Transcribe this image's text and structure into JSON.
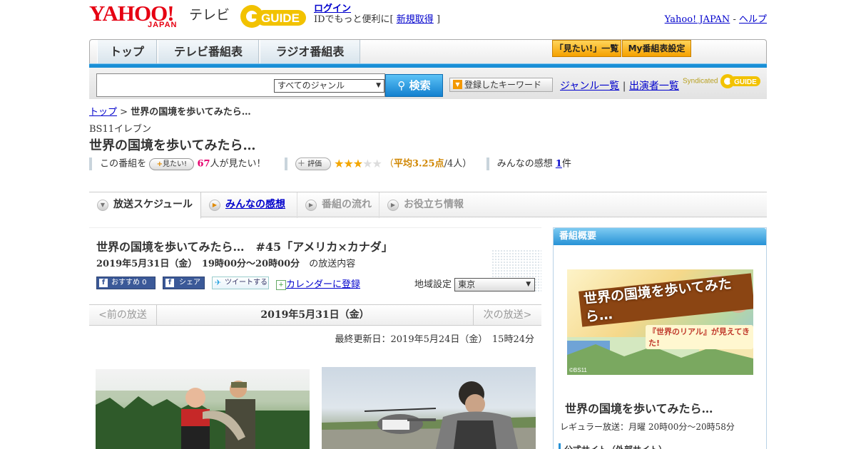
{
  "header": {
    "yahoo_word": "YAHOO!",
    "yahoo_japan": "JAPAN",
    "tv": "テレビ",
    "gguide": "GUIDE",
    "login": "ログイン",
    "id_text": "IDでもっと便利に[",
    "signup": "新規取得",
    "id_close": "]",
    "yahoo_japan_link": "Yahoo! JAPAN",
    "dash": "-",
    "help": "ヘルプ"
  },
  "nav": {
    "tabs": [
      "トップ",
      "テレビ番組表",
      "ラジオ番組表"
    ],
    "mitai_list": "「見たい!」一覧",
    "my_program": "My番組表設定"
  },
  "search": {
    "genre_selected": "すべてのジャンル",
    "search_button": "検索",
    "keyword_button": "登録したキーワード",
    "genre_list": "ジャンル一覧",
    "pipe": "|",
    "cast_list": "出演者一覧",
    "syndicated": "Syndicated",
    "gguide": "GUIDE"
  },
  "breadcrumb": {
    "top": "トップ",
    "sep": " > ",
    "current": "世界の国境を歩いてみたら…"
  },
  "program": {
    "station": "BS11イレブン",
    "title": "世界の国境を歩いてみたら…",
    "kono_bangumi": "この番組を",
    "mitai_btn": "見たい!",
    "mitai_count": "67",
    "mitai_suffix": "人が見たい！",
    "hyouka_btn": "評価",
    "rating": 3.25,
    "avg_prefix": "（",
    "avg_label": "平均3.25点",
    "avg_suffix": "/4人）",
    "kansou_label": "みんなの感想",
    "kansou_count": "1",
    "kansou_unit": "件"
  },
  "subtabs": [
    "放送スケジュール",
    "みんなの感想",
    "番組の流れ",
    "お役立ち情報"
  ],
  "episode": {
    "title": "世界の国境を歩いてみたら…　#45「アメリカ×カナダ」",
    "date_time": "2019年5月31日（金）　19時00分～20時00分",
    "date_suffix": "の放送内容",
    "fb_recommend": "おすすめ 0",
    "fb_share": "シェア",
    "tweet": "ツイートする",
    "calendar": "カレンダーに登録",
    "region_label": "地域設定",
    "region_selected": "東京"
  },
  "pager": {
    "prev": "<前の放送",
    "current": "2019年5月31日（金）",
    "next": "次の放送>"
  },
  "updated": "最終更新日：2019年5月24日（金）　15時24分",
  "sidebar": {
    "header": "番組概要",
    "image_title": "世界の国境を歩いてみたら…",
    "image_sub": "『世界のリアル』が見えてきた!",
    "image_copyright": "©BS11",
    "title": "世界の国境を歩いてみたら…",
    "regular": "レギュラー放送：月曜 20時00分～20時58分",
    "official": "公式サイト（外部サイト）"
  },
  "colors": {
    "yahoo_red": "#e60012",
    "nav_blue": "#1a8fd6",
    "accent_orange": "#f5a100",
    "link": "#0000cc",
    "pink": "#e5006e"
  }
}
